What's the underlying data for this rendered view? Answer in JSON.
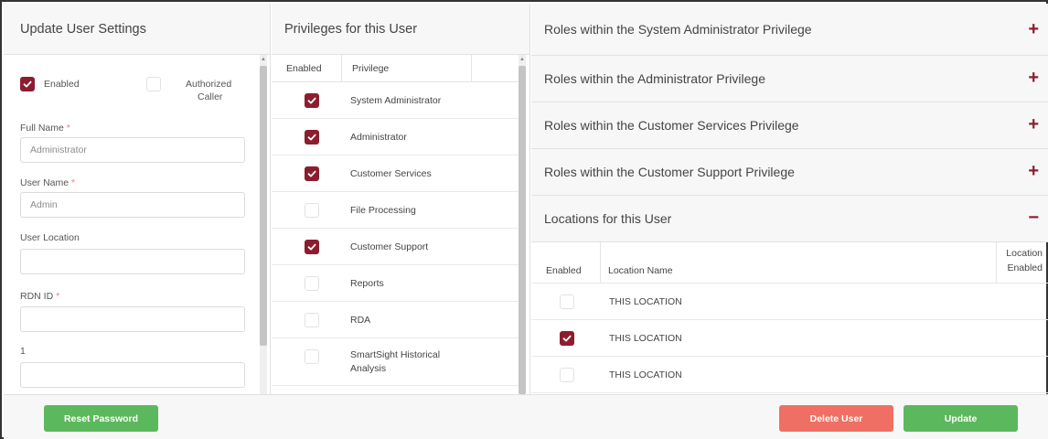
{
  "user_settings": {
    "title": "Update User Settings",
    "enabled_label": "Enabled",
    "enabled_checked": true,
    "authorized_caller_label_line1": "Authorized",
    "authorized_caller_label_line2": "Caller",
    "authorized_caller_checked": false,
    "full_name_label": "Full Name",
    "full_name_value": "Administrator",
    "user_name_label": "User Name",
    "user_name_value": "Admin",
    "user_location_label": "User Location",
    "user_location_value": "",
    "rdn_id_label": "RDN ID",
    "rdn_id_value": "",
    "extra_field_label": "1",
    "extra_field_value": "",
    "required_marker": "*"
  },
  "privileges": {
    "title": "Privileges for this User",
    "col_enabled": "Enabled",
    "col_privilege": "Privilege",
    "items": [
      {
        "name": "System Administrator",
        "enabled": true
      },
      {
        "name": "Administrator",
        "enabled": true
      },
      {
        "name": "Customer Services",
        "enabled": true
      },
      {
        "name": "File Processing",
        "enabled": false
      },
      {
        "name": "Customer Support",
        "enabled": true
      },
      {
        "name": "Reports",
        "enabled": false
      },
      {
        "name": "RDA",
        "enabled": false
      },
      {
        "name_line1": "SmartSight Historical",
        "name_line2": "Analysis",
        "enabled": false
      }
    ]
  },
  "roles": {
    "sections": [
      {
        "title": "Roles within the System Administrator Privilege",
        "toggle": "+"
      },
      {
        "title": "Roles within the Administrator Privilege",
        "toggle": "+"
      },
      {
        "title": "Roles within the Customer Services Privilege",
        "toggle": "+"
      },
      {
        "title": "Roles within the Customer Support Privilege",
        "toggle": "+"
      }
    ]
  },
  "locations": {
    "title": "Locations for this User",
    "toggle": "−",
    "col_enabled": "Enabled",
    "col_location_name": "Location Name",
    "col_location_enabled_line1": "Location",
    "col_location_enabled_line2": "Enabled",
    "rows": [
      {
        "name": "THIS LOCATION",
        "enabled": false
      },
      {
        "name": "THIS LOCATION",
        "enabled": true
      },
      {
        "name": "THIS LOCATION",
        "enabled": false
      }
    ]
  },
  "footer": {
    "reset_password_label": "Reset Password",
    "delete_user_label": "Delete User",
    "update_label": "Update"
  },
  "colors": {
    "accent": "#8c1d2f",
    "button_green": "#5cb85c",
    "button_red": "#ef6f64",
    "header_bg": "#f7f7f7"
  },
  "icons": {
    "checkbox_checked": "check-icon",
    "expand": "plus-icon",
    "collapse": "minus-icon"
  }
}
